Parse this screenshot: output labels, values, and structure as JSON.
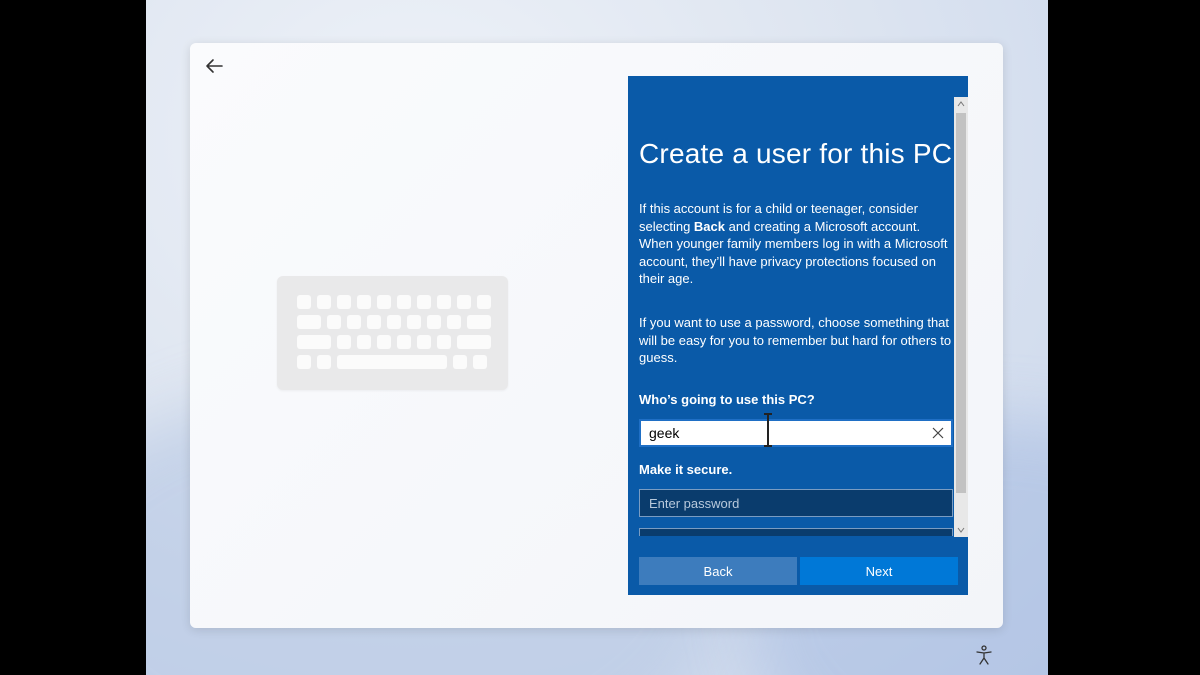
{
  "header": {
    "back_icon": "back-arrow-icon"
  },
  "panel": {
    "title": "Create a user for this PC",
    "desc1_pre": "If this account is for a child or teenager, consider selecting ",
    "desc1_bold": "Back",
    "desc1_post": " and creating a Microsoft account. When younger family members log in with a Microsoft account, they’ll have privacy protections focused on their age.",
    "desc2": "If you want to use a password, choose something that will be easy for you to remember but hard for others to guess.",
    "username_label": "Who’s going to use this PC?",
    "username_value": "geek",
    "password_label": "Make it secure.",
    "password_placeholder": "Enter password",
    "back_button": "Back",
    "next_button": "Next"
  },
  "colors": {
    "panel_bg": "#0a5aa8",
    "next_button": "#0078d7",
    "back_button": "#3d7cbd"
  },
  "footer": {
    "accessibility_icon": "ease-of-access-icon"
  }
}
